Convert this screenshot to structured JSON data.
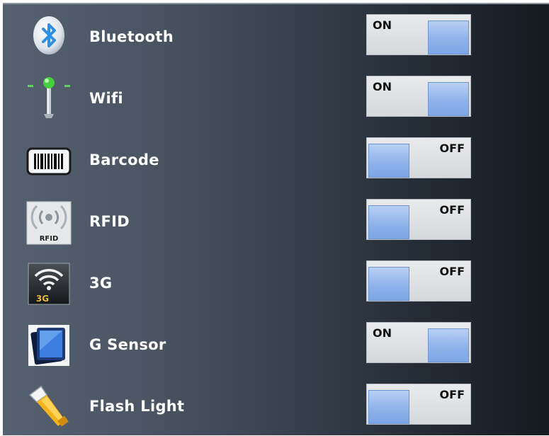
{
  "settings": [
    {
      "label": "Bluetooth",
      "state": "ON",
      "icon": "bluetooth-icon"
    },
    {
      "label": "Wifi",
      "state": "ON",
      "icon": "wifi-antenna-icon"
    },
    {
      "label": "Barcode",
      "state": "OFF",
      "icon": "barcode-icon"
    },
    {
      "label": "RFID",
      "state": "OFF",
      "icon": "rfid-icon",
      "icon_text": "RFID"
    },
    {
      "label": "3G",
      "state": "OFF",
      "icon": "3g-signal-icon",
      "icon_text": "3G"
    },
    {
      "label": "G Sensor",
      "state": "ON",
      "icon": "g-sensor-icon"
    },
    {
      "label": "Flash Light",
      "state": "OFF",
      "icon": "flashlight-icon"
    }
  ],
  "colors": {
    "knob": "#8fb3ea",
    "track": "#dcdfe2",
    "label_text": "#ffffff"
  }
}
